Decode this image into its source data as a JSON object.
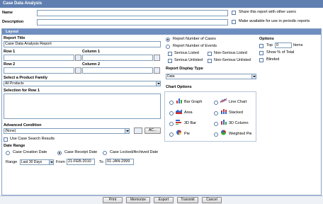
{
  "window": {
    "title": "Case Data Analysis"
  },
  "header": {
    "name_label": "Name",
    "name_value": "",
    "description_label": "Description",
    "description_value": "",
    "share_label": "Share this report with other users",
    "periodic_label": "Make available for use in periodic reports"
  },
  "layout": {
    "section_title": "Layout",
    "report_title_label": "Report Title",
    "report_title_value": "Case Data Analysis Report",
    "row1_label": "Row 1",
    "column1_label": "Column 1",
    "row2_label": "Row 2",
    "column2_label": "Column 2",
    "product_family_label": "Select a Product Family",
    "product_family_value": "All Products",
    "selection_label": "Selection for Row 1",
    "advanced_condition_label": "Advanced Condition",
    "advanced_condition_value": "(None)",
    "ac_button": "AC...",
    "use_search_results_label": "Use Case Search Results",
    "date_range_label": "Date Range",
    "date_options": [
      "Case Creation Date",
      "Case Receipt Date",
      "Case Locked/Archived Date"
    ],
    "date_selected": "Case Receipt Date",
    "range_label": "Range",
    "range_value": "Last 30 Days",
    "from_label": "From",
    "from_value": "21-FEB-2010",
    "to_label": "To",
    "to_value": "01-JAN-2999"
  },
  "report_type": {
    "number_of_cases": "Report Number of Cases",
    "number_of_events": "Report Number of Events",
    "selected": "Report Number of Cases",
    "serious_listed": "Serious Listed",
    "non_serious_listed": "Non-Serious Listed",
    "serious_unlisted": "Serious Unlisted",
    "non_serious_unlisted": "Non-Serious Unlisted"
  },
  "options": {
    "title": "Options",
    "top_label": "Top",
    "top_value": "0",
    "items_label": "Items",
    "show_pct_label": "Show % of Total",
    "blinded_label": "Blinded"
  },
  "display": {
    "type_label": "Report Display Type",
    "type_value": "Data",
    "chart_options_label": "Chart Options",
    "charts": [
      {
        "label": "Bar Graph",
        "icon": "bar-graph-icon"
      },
      {
        "label": "Line Chart",
        "icon": "line-chart-icon"
      },
      {
        "label": "Area",
        "icon": "area-chart-icon"
      },
      {
        "label": "Stacked",
        "icon": "stacked-chart-icon"
      },
      {
        "label": "3D Bar",
        "icon": "3d-bar-icon"
      },
      {
        "label": "3D Column",
        "icon": "3d-column-icon"
      },
      {
        "label": "Pie",
        "icon": "pie-chart-icon"
      },
      {
        "label": "Weighted Pie",
        "icon": "weighted-pie-icon"
      }
    ]
  },
  "footer": {
    "buttons": [
      "Print",
      "Memorize",
      "Export",
      "Transmit",
      "Cancel"
    ]
  },
  "colors": {
    "titlebar": "#5f7fb0",
    "section_head": "#6f8ec0",
    "border": "#7f9db9"
  }
}
